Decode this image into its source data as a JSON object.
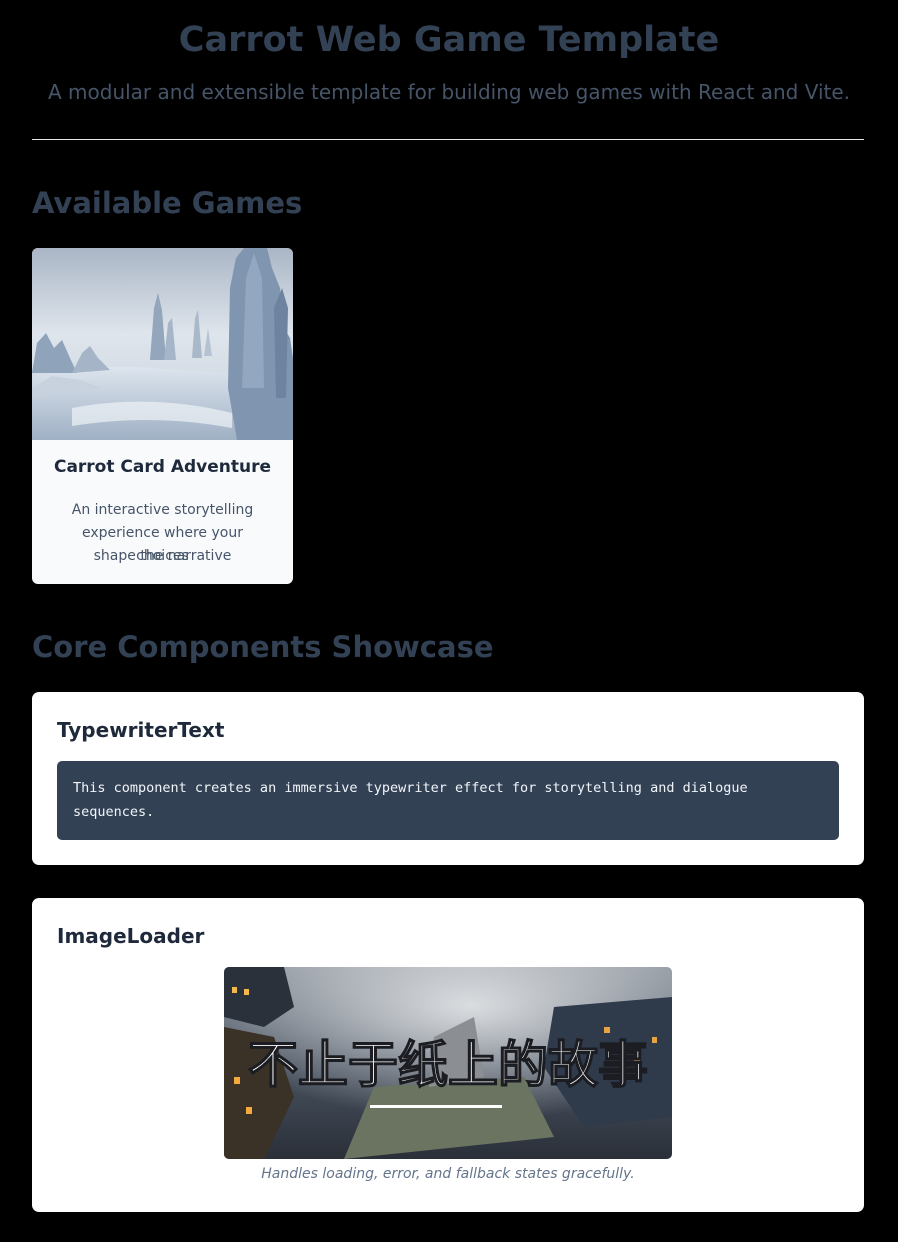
{
  "header": {
    "title": "Carrot Web Game Template",
    "subtitle": "A modular and extensible template for building web games with React and Vite."
  },
  "games_section": {
    "heading": "Available Games",
    "games": [
      {
        "title": "Carrot Card Adventure",
        "description_lines": [
          "An interactive storytelling",
          "experience where your choices",
          "shape the narrative"
        ]
      }
    ]
  },
  "components_section": {
    "heading": "Core Components Showcase",
    "typewriter": {
      "title": "TypewriterText",
      "text_lines": [
        "This component creates an immersive typewriter effect for storytelling and dialogue",
        "sequences."
      ]
    },
    "image_loader": {
      "title": "ImageLoader",
      "image_text": "不止于纸上的故事",
      "caption": "Handles loading, error, and fallback states gracefully."
    }
  },
  "colors": {
    "background": "#000000",
    "heading": "#334155",
    "card_bg": "#f8fafc",
    "panel_bg": "#ffffff",
    "code_bg": "#334155"
  }
}
